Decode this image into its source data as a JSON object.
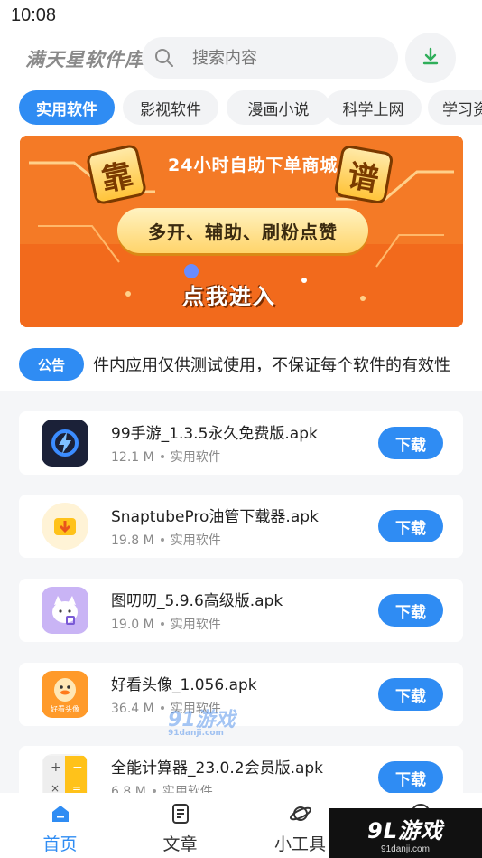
{
  "status_bar": {
    "time": "10:08"
  },
  "header": {
    "app_title": "满天星软件库",
    "search_placeholder": "搜索内容"
  },
  "tabs": [
    {
      "label": "实用软件",
      "active": true
    },
    {
      "label": "影视软件",
      "active": false
    },
    {
      "label": "漫画小说",
      "active": false
    },
    {
      "label": "科学上网",
      "active": false
    },
    {
      "label": "学习资",
      "active": false
    }
  ],
  "banner": {
    "title": "24小时自助下单商城",
    "char_left": "靠",
    "char_right": "谱",
    "pill_text": "多开、辅助、刷粉点赞",
    "cta": "点我进入"
  },
  "notice": {
    "badge": "公告",
    "text": "件内应用仅供测试使用，不保证每个软件的有效性"
  },
  "apps": [
    {
      "name": "99手游_1.3.5永久免费版.apk",
      "size": "12.1 M",
      "category": "实用软件",
      "button": "下载",
      "icon": "lightning-app-icon"
    },
    {
      "name": "SnaptubePro油管下载器.apk",
      "size": "19.8 M",
      "category": "实用软件",
      "button": "下载",
      "icon": "download-arrow-app-icon"
    },
    {
      "name": "图叨叨_5.9.6高级版.apk",
      "size": "19.0 M",
      "category": "实用软件",
      "button": "下载",
      "icon": "cat-app-icon"
    },
    {
      "name": "好看头像_1.056.apk",
      "size": "36.4 M",
      "category": "实用软件",
      "button": "下载",
      "icon": "duck-app-icon",
      "icon_caption": "好看头像"
    },
    {
      "name": "全能计算器_23.0.2会员版.apk",
      "size": "6.8 M",
      "category": "实用软件",
      "button": "下载",
      "icon": "calculator-app-icon"
    }
  ],
  "bottom_nav": [
    {
      "label": "首页",
      "icon": "home-icon",
      "active": true
    },
    {
      "label": "文章",
      "icon": "article-icon",
      "active": false
    },
    {
      "label": "小工具",
      "icon": "planet-icon",
      "active": false
    },
    {
      "label": "",
      "icon": "profile-icon",
      "active": false
    }
  ],
  "watermarks": {
    "center": "91游戏",
    "center_sub": "91danji.com",
    "corner": "9L游戏",
    "corner_sub": "91danji.com"
  },
  "colors": {
    "accent": "#2f8cf3",
    "banner_bg": "#f26a1c",
    "page_bg": "#f5f6f8"
  }
}
